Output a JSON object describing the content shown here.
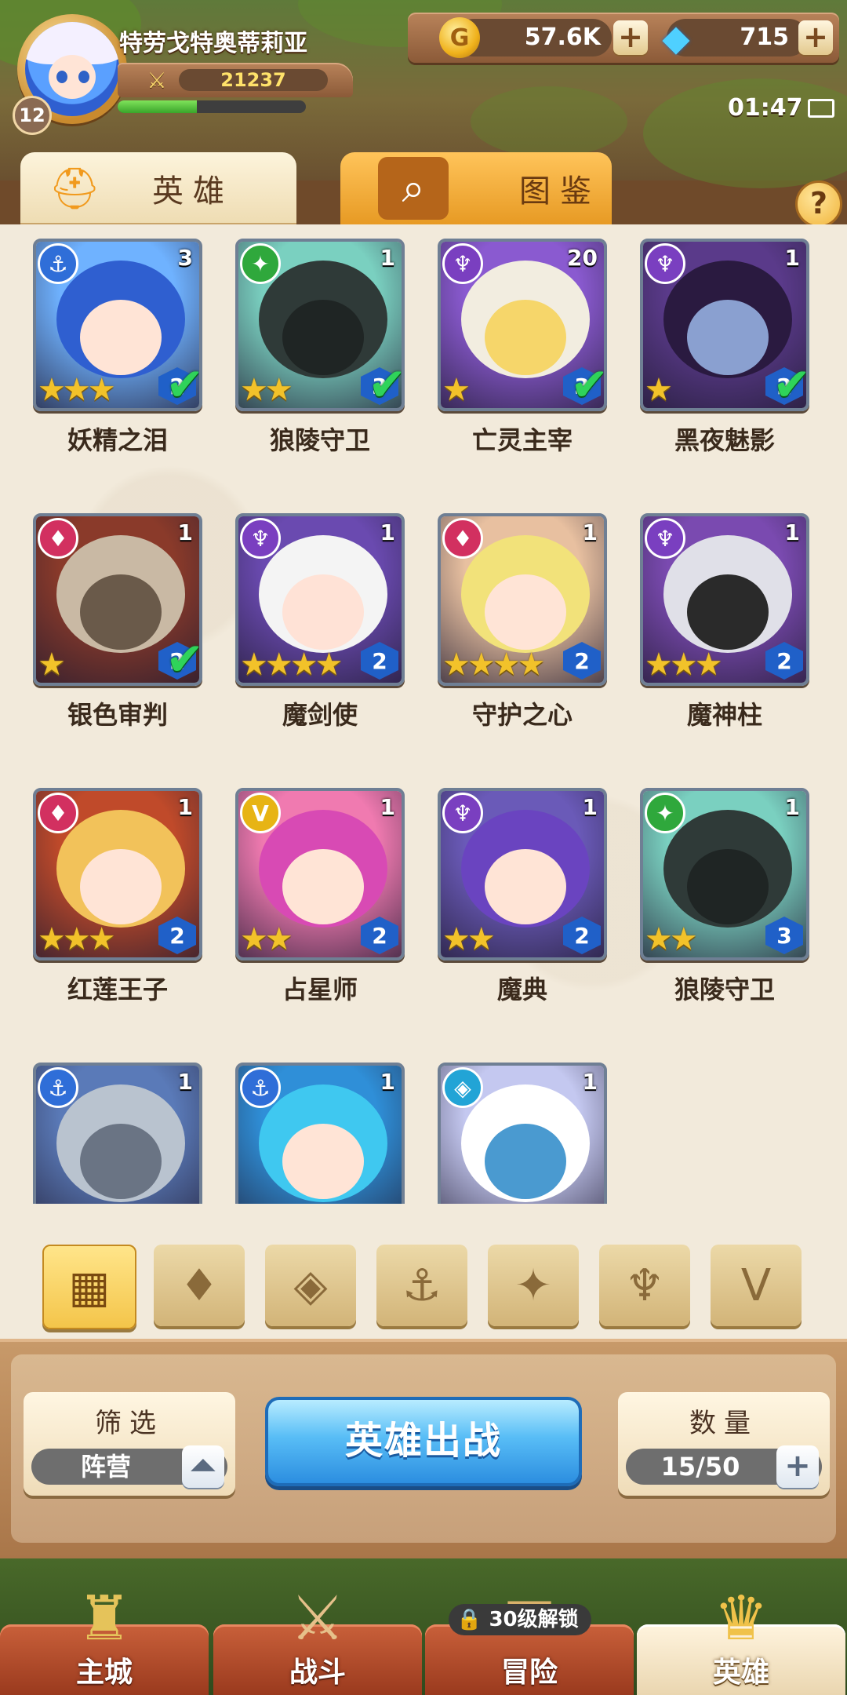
{
  "player": {
    "name": "特劳戈特奥蒂莉亚",
    "level": "12",
    "power": "21237",
    "xp_fraction": 0.42
  },
  "currency": {
    "gold": "57.6K",
    "gems": "715",
    "plus": "+"
  },
  "status": {
    "time": "01:47"
  },
  "tabs": [
    {
      "label": "英雄",
      "icon": "helmet-icon",
      "active": true
    },
    {
      "label": "图鉴",
      "icon": "magnifier-book-icon",
      "active": false
    }
  ],
  "help_label": "?",
  "heroes": [
    {
      "name": "妖精之泪",
      "faction": "anchor",
      "count": "3",
      "stars": 3,
      "rank": "2",
      "ready": true
    },
    {
      "name": "狼陵守卫",
      "faction": "beast",
      "count": "1",
      "stars": 2,
      "rank": "3",
      "ready": true
    },
    {
      "name": "亡灵主宰",
      "faction": "demon",
      "count": "20",
      "stars": 1,
      "rank": "3",
      "ready": true
    },
    {
      "name": "黑夜魅影",
      "faction": "demon",
      "count": "1",
      "stars": 1,
      "rank": "2",
      "ready": true
    },
    {
      "name": "银色审判",
      "faction": "flame",
      "count": "1",
      "stars": 1,
      "rank": "2",
      "ready": true
    },
    {
      "name": "魔剑使",
      "faction": "demon",
      "count": "1",
      "stars": 4,
      "rank": "2",
      "ready": false
    },
    {
      "name": "守护之心",
      "faction": "flame",
      "count": "1",
      "stars": 4,
      "rank": "2",
      "ready": false
    },
    {
      "name": "魔神柱",
      "faction": "demon",
      "count": "1",
      "stars": 3,
      "rank": "2",
      "ready": false
    },
    {
      "name": "红莲王子",
      "faction": "flame",
      "count": "1",
      "stars": 3,
      "rank": "2",
      "ready": false
    },
    {
      "name": "占星师",
      "faction": "wing",
      "count": "1",
      "stars": 2,
      "rank": "2",
      "ready": false
    },
    {
      "name": "魔典",
      "faction": "demon",
      "count": "1",
      "stars": 2,
      "rank": "2",
      "ready": false
    },
    {
      "name": "狼陵守卫",
      "faction": "beast",
      "count": "1",
      "stars": 2,
      "rank": "3",
      "ready": false
    },
    {
      "name": "",
      "faction": "anchor",
      "count": "1",
      "stars": 0,
      "rank": "",
      "ready": false
    },
    {
      "name": "",
      "faction": "anchor",
      "count": "1",
      "stars": 0,
      "rank": "",
      "ready": false
    },
    {
      "name": "",
      "faction": "crystal",
      "count": "1",
      "stars": 0,
      "rank": "",
      "ready": false
    }
  ],
  "faction_filters": [
    {
      "name": "all-factions",
      "icon": "grid-icon",
      "active": true
    },
    {
      "name": "flame",
      "icon": "flame-icon",
      "active": false
    },
    {
      "name": "crystal",
      "icon": "crystal-icon",
      "active": false
    },
    {
      "name": "anchor",
      "icon": "anchor-icon",
      "active": false
    },
    {
      "name": "beast",
      "icon": "beast-icon",
      "active": false
    },
    {
      "name": "demon",
      "icon": "demon-horn-icon",
      "active": false
    },
    {
      "name": "wing",
      "icon": "wing-icon",
      "active": false
    }
  ],
  "filter_panel": {
    "title": "筛选",
    "value": "阵营"
  },
  "deploy_button": "英雄出战",
  "quantity_panel": {
    "title": "数量",
    "value": "15/50"
  },
  "bottom_nav": [
    {
      "label": "主城",
      "icon": "castle-icon",
      "active": false
    },
    {
      "label": "战斗",
      "icon": "crossed-swords-icon",
      "active": false
    },
    {
      "label": "冒险",
      "icon": "map-scroll-icon",
      "active": false,
      "lock": "30级解锁"
    },
    {
      "label": "英雄",
      "icon": "hero-crest-icon",
      "active": true
    }
  ],
  "colors": {
    "panel": "#f2eadb",
    "deploy_blue": "#2c8ee0",
    "star_gold": "#f2c22a",
    "check_green": "#2fd35a"
  }
}
